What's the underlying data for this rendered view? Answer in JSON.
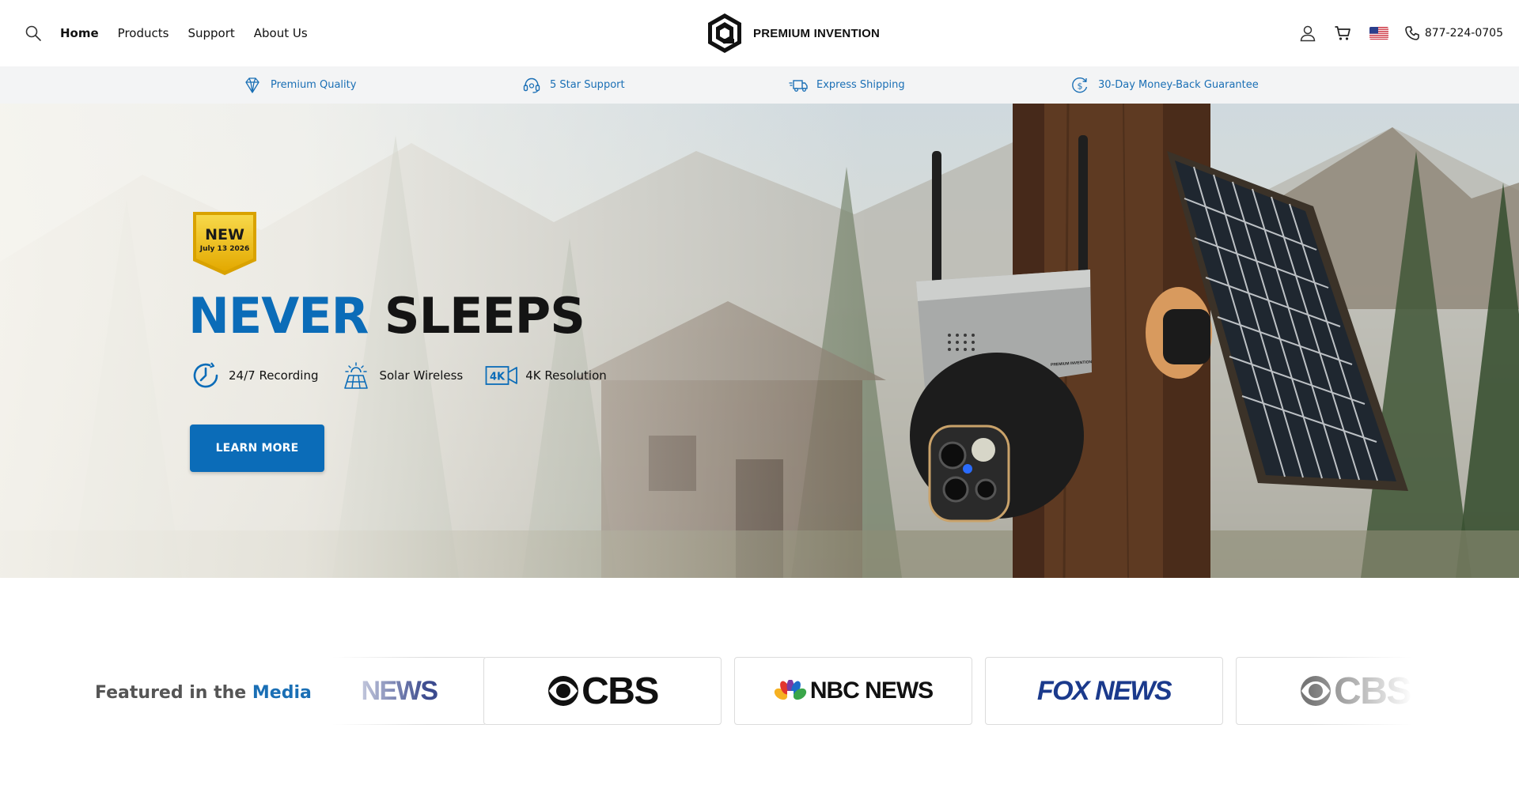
{
  "header": {
    "nav": [
      {
        "label": "Home",
        "active": true
      },
      {
        "label": "Products",
        "active": false
      },
      {
        "label": "Support",
        "active": false
      },
      {
        "label": "About Us",
        "active": false
      }
    ],
    "brand_name": "PREMIUM INVENTION",
    "phone": "877-224-0705",
    "icons": [
      "search-icon",
      "user-icon",
      "cart-icon",
      "us-flag-icon",
      "phone-icon"
    ]
  },
  "benefits": [
    {
      "icon": "diamond-icon",
      "label": "Premium Quality"
    },
    {
      "icon": "headset-icon",
      "label": "5 Star Support"
    },
    {
      "icon": "truck-icon",
      "label": "Express Shipping"
    },
    {
      "icon": "dollar-refresh-icon",
      "label": "30-Day Money-Back Guarantee"
    }
  ],
  "hero": {
    "badge": {
      "line1": "NEW",
      "line2": "July 13 2026"
    },
    "title_accent": "NEVER",
    "title_rest": "SLEEPS",
    "features": [
      {
        "icon": "clock-icon",
        "label": "24/7 Recording"
      },
      {
        "icon": "solar-panel-icon",
        "label": "Solar Wireless"
      },
      {
        "icon": "4k-icon",
        "label": "4K Resolution"
      }
    ],
    "cta": "LEARN MORE",
    "camera_brand": "PREMIUM INVENTION"
  },
  "media": {
    "heading_prefix": "Featured in the",
    "heading_accent": "Media",
    "logos": [
      "NEWS",
      "CBS",
      "NBC NEWS",
      "FOX NEWS",
      "CBS"
    ]
  },
  "colors": {
    "accent": "#0b6cb8",
    "benefit_text": "#1a6fb5",
    "badge_gold": "#f2c415",
    "fox_blue": "#1b3a8c"
  }
}
